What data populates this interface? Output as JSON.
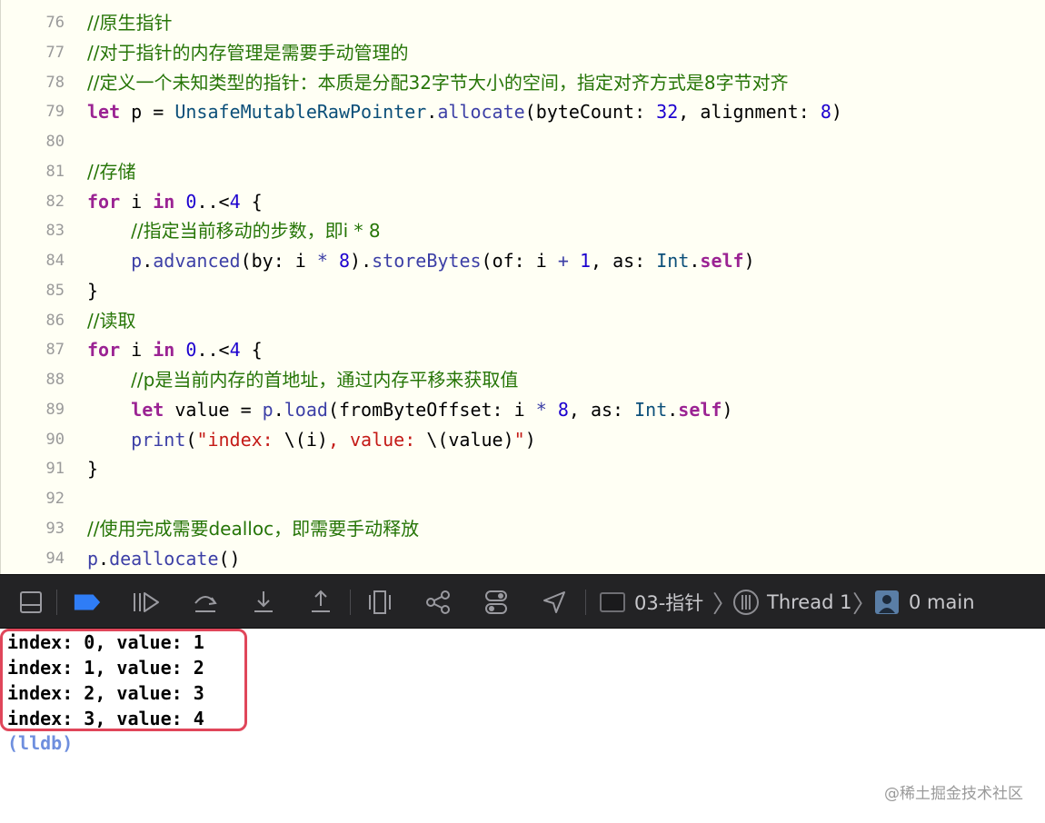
{
  "editor": {
    "lines": [
      {
        "no": "76",
        "tokens": [
          {
            "t": "cm",
            "v": "//原生指针"
          }
        ]
      },
      {
        "no": "77",
        "tokens": [
          {
            "t": "cm",
            "v": "//对于指针的内存管理是需要手动管理的"
          }
        ]
      },
      {
        "no": "78",
        "tokens": [
          {
            "t": "cm",
            "v": "//定义一个未知类型的指针：本质是分配32字节大小的空间，指定对齐方式是8字节对齐"
          }
        ]
      },
      {
        "no": "79",
        "tokens": [
          {
            "t": "kw",
            "v": "let"
          },
          {
            "t": "pl",
            "v": " p = "
          },
          {
            "t": "ty",
            "v": "UnsafeMutableRawPointer"
          },
          {
            "t": "pl",
            "v": "."
          },
          {
            "t": "fn",
            "v": "allocate"
          },
          {
            "t": "pl",
            "v": "(byteCount: "
          },
          {
            "t": "num",
            "v": "32"
          },
          {
            "t": "pl",
            "v": ", alignment: "
          },
          {
            "t": "num",
            "v": "8"
          },
          {
            "t": "pl",
            "v": ")"
          }
        ]
      },
      {
        "no": "80",
        "tokens": []
      },
      {
        "no": "81",
        "tokens": [
          {
            "t": "cm",
            "v": "//存储"
          }
        ]
      },
      {
        "no": "82",
        "tokens": [
          {
            "t": "kw",
            "v": "for"
          },
          {
            "t": "pl",
            "v": " i "
          },
          {
            "t": "kw",
            "v": "in"
          },
          {
            "t": "pl",
            "v": " "
          },
          {
            "t": "num",
            "v": "0"
          },
          {
            "t": "pl",
            "v": "..<"
          },
          {
            "t": "num",
            "v": "4"
          },
          {
            "t": "pl",
            "v": " {"
          }
        ]
      },
      {
        "no": "83",
        "tokens": [
          {
            "t": "pl",
            "v": "    "
          },
          {
            "t": "cm",
            "v": "//指定当前移动的步数，即i * 8"
          }
        ]
      },
      {
        "no": "84",
        "tokens": [
          {
            "t": "pl",
            "v": "    "
          },
          {
            "t": "fn",
            "v": "p"
          },
          {
            "t": "pl",
            "v": "."
          },
          {
            "t": "fn",
            "v": "advanced"
          },
          {
            "t": "pl",
            "v": "(by: i "
          },
          {
            "t": "fn",
            "v": "*"
          },
          {
            "t": "pl",
            "v": " "
          },
          {
            "t": "num",
            "v": "8"
          },
          {
            "t": "pl",
            "v": ")."
          },
          {
            "t": "fn",
            "v": "storeBytes"
          },
          {
            "t": "pl",
            "v": "(of: i "
          },
          {
            "t": "fn",
            "v": "+"
          },
          {
            "t": "pl",
            "v": " "
          },
          {
            "t": "num",
            "v": "1"
          },
          {
            "t": "pl",
            "v": ", as: "
          },
          {
            "t": "ty",
            "v": "Int"
          },
          {
            "t": "pl",
            "v": "."
          },
          {
            "t": "kw",
            "v": "self"
          },
          {
            "t": "pl",
            "v": ")"
          }
        ]
      },
      {
        "no": "85",
        "tokens": [
          {
            "t": "pl",
            "v": "}"
          }
        ]
      },
      {
        "no": "86",
        "tokens": [
          {
            "t": "cm",
            "v": "//读取"
          }
        ]
      },
      {
        "no": "87",
        "tokens": [
          {
            "t": "kw",
            "v": "for"
          },
          {
            "t": "pl",
            "v": " i "
          },
          {
            "t": "kw",
            "v": "in"
          },
          {
            "t": "pl",
            "v": " "
          },
          {
            "t": "num",
            "v": "0"
          },
          {
            "t": "pl",
            "v": "..<"
          },
          {
            "t": "num",
            "v": "4"
          },
          {
            "t": "pl",
            "v": " {"
          }
        ]
      },
      {
        "no": "88",
        "tokens": [
          {
            "t": "pl",
            "v": "    "
          },
          {
            "t": "cm",
            "v": "//p是当前内存的首地址，通过内存平移来获取值"
          }
        ]
      },
      {
        "no": "89",
        "tokens": [
          {
            "t": "pl",
            "v": "    "
          },
          {
            "t": "kw",
            "v": "let"
          },
          {
            "t": "pl",
            "v": " value = "
          },
          {
            "t": "fn",
            "v": "p"
          },
          {
            "t": "pl",
            "v": "."
          },
          {
            "t": "fn",
            "v": "load"
          },
          {
            "t": "pl",
            "v": "(fromByteOffset: i "
          },
          {
            "t": "fn",
            "v": "*"
          },
          {
            "t": "pl",
            "v": " "
          },
          {
            "t": "num",
            "v": "8"
          },
          {
            "t": "pl",
            "v": ", as: "
          },
          {
            "t": "ty",
            "v": "Int"
          },
          {
            "t": "pl",
            "v": "."
          },
          {
            "t": "kw",
            "v": "self"
          },
          {
            "t": "pl",
            "v": ")"
          }
        ]
      },
      {
        "no": "90",
        "tokens": [
          {
            "t": "pl",
            "v": "    "
          },
          {
            "t": "fn",
            "v": "print"
          },
          {
            "t": "pl",
            "v": "("
          },
          {
            "t": "str",
            "v": "\"index: "
          },
          {
            "t": "pl",
            "v": "\\(i)"
          },
          {
            "t": "str",
            "v": ", value: "
          },
          {
            "t": "pl",
            "v": "\\(value)"
          },
          {
            "t": "str",
            "v": "\""
          },
          {
            "t": "pl",
            "v": ")"
          }
        ]
      },
      {
        "no": "91",
        "tokens": [
          {
            "t": "pl",
            "v": "}"
          }
        ]
      },
      {
        "no": "92",
        "tokens": []
      },
      {
        "no": "93",
        "tokens": [
          {
            "t": "cm",
            "v": "//使用完成需要dealloc，即需要手动释放"
          }
        ]
      },
      {
        "no": "94",
        "tokens": [
          {
            "t": "fn",
            "v": "p"
          },
          {
            "t": "pl",
            "v": "."
          },
          {
            "t": "fn",
            "v": "deallocate"
          },
          {
            "t": "pl",
            "v": "()"
          }
        ]
      }
    ]
  },
  "debug_bar": {
    "buttons": [
      {
        "name": "hide-debug-area-button",
        "icon": "panel-bottom-icon"
      },
      {
        "name": "breakpoints-toggle-button",
        "icon": "breakpoint-icon",
        "active": true
      },
      {
        "name": "continue-button",
        "icon": "continue-icon"
      },
      {
        "name": "step-over-button",
        "icon": "step-over-icon"
      },
      {
        "name": "step-into-button",
        "icon": "step-into-icon"
      },
      {
        "name": "step-out-button",
        "icon": "step-out-icon"
      },
      {
        "name": "view-hierarchy-button",
        "icon": "view-hierarchy-icon"
      },
      {
        "name": "memory-graph-button",
        "icon": "memory-graph-icon"
      },
      {
        "name": "environment-overrides-button",
        "icon": "toggles-icon"
      },
      {
        "name": "simulate-location-button",
        "icon": "location-arrow-icon"
      }
    ],
    "breadcrumb": {
      "target": "03-指针",
      "thread": "Thread 1",
      "frame": "0 main"
    },
    "accent_color": "#2f7df6"
  },
  "console": {
    "output": [
      "index: 0, value: 1",
      "index: 1, value: 2",
      "index: 2, value: 3",
      "index: 3, value: 4"
    ],
    "prompt": "(lldb)",
    "highlight_color": "#e0465a"
  },
  "watermark": "@稀土掘金技术社区"
}
